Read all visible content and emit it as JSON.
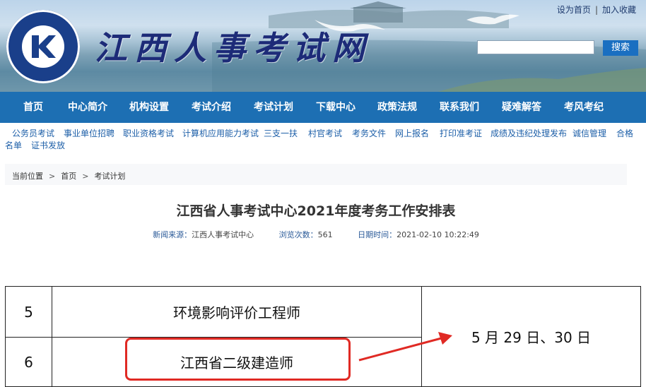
{
  "header": {
    "site_name": "江西人事考试网",
    "top_links": [
      "设为首页",
      "加入收藏"
    ],
    "top_links_sep": "|",
    "search_placeholder": "",
    "search_button": "搜索"
  },
  "main_nav": [
    "首页",
    "中心简介",
    "机构设置",
    "考试介绍",
    "考试计划",
    "下载中心",
    "政策法规",
    "联系我们",
    "疑难解答",
    "考风考纪"
  ],
  "sub_nav": [
    "公务员考试",
    "事业单位招聘",
    "职业资格考试",
    "计算机应用能力考试",
    "三支一扶",
    "村官考试",
    "考务文件",
    "网上报名",
    "打印准考证",
    "成绩及违纪处理发布",
    "诚信管理",
    "合格",
    "名单",
    "证书发放"
  ],
  "breadcrumb": {
    "label": "当前位置",
    "sep": ">",
    "items": [
      "首页",
      "考试计划"
    ]
  },
  "article": {
    "title": "江西省人事考试中心2021年度考务工作安排表",
    "source_label": "新闻来源：",
    "source": "江西人事考试中心",
    "views_label": "浏览次数：",
    "views": "561",
    "date_label": "日期时间：",
    "date": "2021-02-10 10:22:49"
  },
  "table": {
    "rows": [
      {
        "no": "5",
        "name": "环境影响评价工程师"
      },
      {
        "no": "6",
        "name": "江西省二级建造师"
      }
    ],
    "date": "5 月 29 日、30 日"
  },
  "colors": {
    "nav_bg": "#1d6fb3",
    "link": "#1d5fa8",
    "highlight": "#e02a24"
  }
}
